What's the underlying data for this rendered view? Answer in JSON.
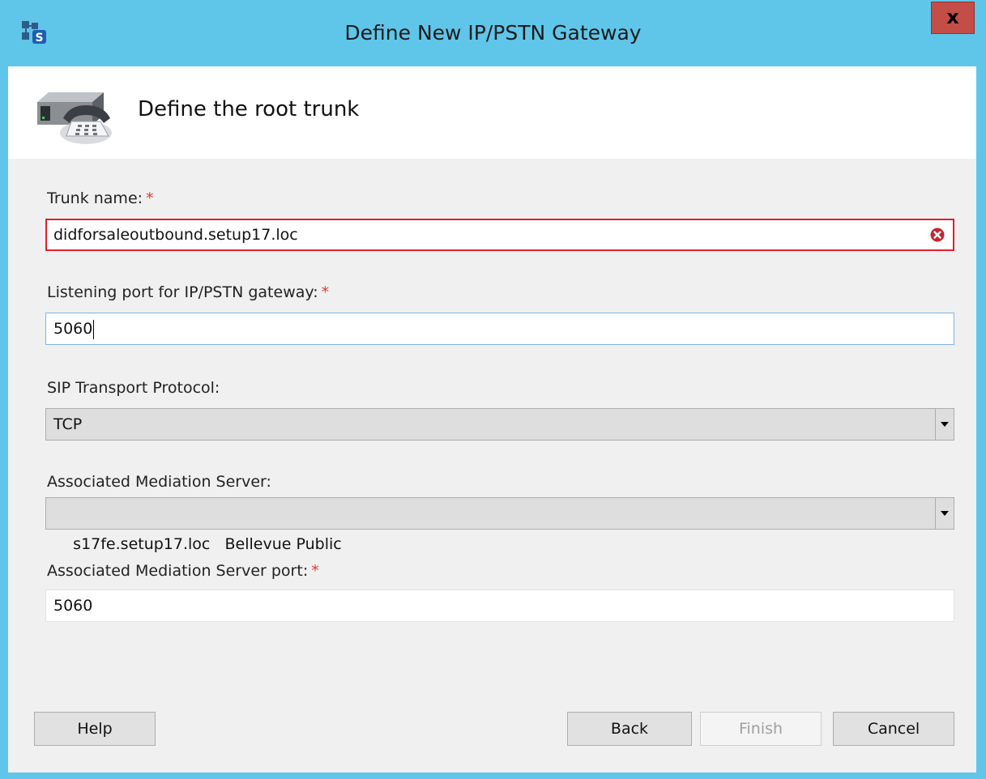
{
  "window": {
    "title": "Define New IP/PSTN Gateway",
    "close_label": "x"
  },
  "header": {
    "title": "Define the root trunk"
  },
  "form": {
    "required_mark": "*",
    "trunk_name": {
      "label": "Trunk name:",
      "value": "didforsaleoutbound.setup17.loc",
      "state": "error"
    },
    "listening_port": {
      "label": "Listening port for IP/PSTN gateway:",
      "value": "5060"
    },
    "sip_transport": {
      "label": "SIP Transport Protocol:",
      "selected": "TCP"
    },
    "mediation_server": {
      "label": "Associated Mediation Server:",
      "selected": "s17fe.setup17.loc   Bellevue Public"
    },
    "mediation_port": {
      "label": "Associated Mediation Server port:",
      "value": "5060"
    }
  },
  "buttons": {
    "help": "Help",
    "back": "Back",
    "finish": "Finish",
    "cancel": "Cancel"
  },
  "colors": {
    "titlebar": "#5fc6e9",
    "close": "#c44d48",
    "error_border": "#e0202e",
    "required": "#e03c31"
  }
}
